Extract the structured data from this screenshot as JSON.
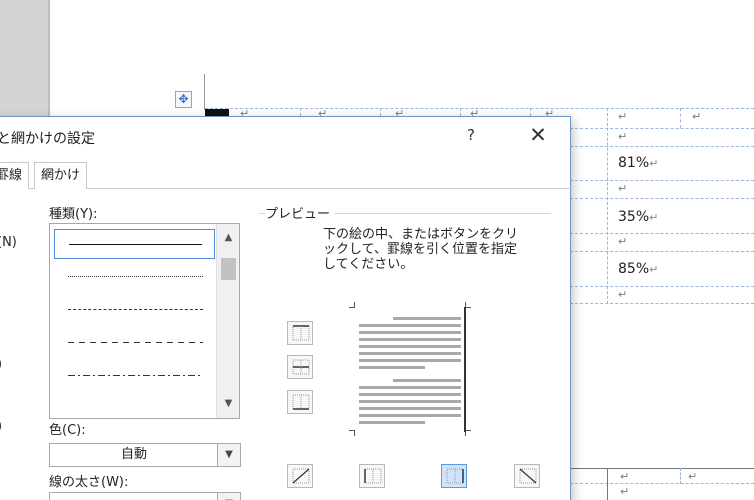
{
  "document": {
    "percents": [
      "81%",
      "35%",
      "85%"
    ],
    "return_mark": "↵"
  },
  "dialog": {
    "title": "と網かけの設定",
    "help": "?",
    "close": "✕",
    "tabs": [
      "罫線",
      "網かけ"
    ],
    "side_labels": [
      "(N)",
      ")",
      ")"
    ],
    "style_label": "種類(Y):",
    "color_label": "色(C):",
    "color_value": "自動",
    "width_label": "線の太さ(W):",
    "preview_title": "プレビュー",
    "preview_instruction": "下の絵の中、またはボタンをクリックして、罫線を引く位置を指定してください。"
  },
  "icons": {
    "move": "move-icon",
    "scroll_up": "chevron-up-icon",
    "scroll_down": "chevron-down-icon"
  }
}
